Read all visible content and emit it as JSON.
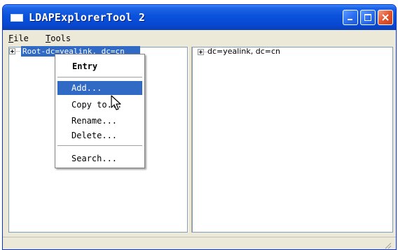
{
  "window": {
    "title": "LDAPExplorerTool 2",
    "controls": [
      "minimize",
      "maximize",
      "close"
    ]
  },
  "menubar": {
    "items": [
      {
        "accel": "F",
        "rest": "ile"
      },
      {
        "accel": "T",
        "rest": "ools"
      }
    ]
  },
  "left_tree": {
    "root_label": "Root-dc=yealink, dc=cn"
  },
  "right_tree": {
    "node_label": "dc=yealink, dc=cn"
  },
  "context_menu": {
    "header": "Entry",
    "items": [
      "Add...",
      "Copy to...",
      "Rename...",
      "Delete...",
      "Search..."
    ],
    "selected_index": 0
  },
  "colors": {
    "titlebar": "#0a52dc",
    "selection": "#316ac5",
    "window_bg": "#ece9d8"
  }
}
